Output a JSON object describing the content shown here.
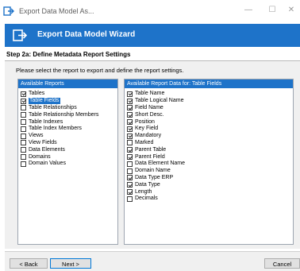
{
  "window": {
    "title": "Export Data Model As...",
    "min_glyph": "—",
    "max_glyph": "☐",
    "close_glyph": "✕"
  },
  "banner": {
    "title": "Export Data Model Wizard",
    "icon": "export-arrow-icon"
  },
  "step": {
    "title": "Step 2a: Define Metadata Report Settings"
  },
  "instruction": "Please select the report to export and define the report settings.",
  "available_reports": {
    "header": "Available Reports",
    "items": [
      {
        "label": "Tables",
        "checked": true,
        "selected": false
      },
      {
        "label": "Table Fields",
        "checked": true,
        "selected": true
      },
      {
        "label": "Table Relationships",
        "checked": false,
        "selected": false
      },
      {
        "label": "Table Relationship Members",
        "checked": false,
        "selected": false
      },
      {
        "label": "Table Indexes",
        "checked": false,
        "selected": false
      },
      {
        "label": "Table Index Members",
        "checked": false,
        "selected": false
      },
      {
        "label": "Views",
        "checked": false,
        "selected": false
      },
      {
        "label": "View Fields",
        "checked": false,
        "selected": false
      },
      {
        "label": "Data Elements",
        "checked": false,
        "selected": false
      },
      {
        "label": "Domains",
        "checked": false,
        "selected": false
      },
      {
        "label": "Domain Values",
        "checked": false,
        "selected": false
      }
    ]
  },
  "report_data": {
    "header": "Available Report Data for: Table Fields",
    "items": [
      {
        "label": "Table Name",
        "checked": true
      },
      {
        "label": "Table Logical Name",
        "checked": true
      },
      {
        "label": "Field Name",
        "checked": true
      },
      {
        "label": "Short Desc.",
        "checked": true
      },
      {
        "label": "Position",
        "checked": true
      },
      {
        "label": "Key Field",
        "checked": true
      },
      {
        "label": "Mandatory",
        "checked": true
      },
      {
        "label": "Marked",
        "checked": false
      },
      {
        "label": "Parent Table",
        "checked": true
      },
      {
        "label": "Parent Field",
        "checked": true
      },
      {
        "label": "Data Element Name",
        "checked": false
      },
      {
        "label": "Domain Name",
        "checked": false
      },
      {
        "label": "Data Type ERP",
        "checked": true
      },
      {
        "label": "Data Type",
        "checked": true
      },
      {
        "label": "Length",
        "checked": true
      },
      {
        "label": "Decimals",
        "checked": false
      }
    ]
  },
  "footer": {
    "back_label": "< Back",
    "next_label": "Next >",
    "cancel_label": "Cancel"
  },
  "colors": {
    "accent": "#1e73c9",
    "panel_bg": "#f0f0f0"
  }
}
